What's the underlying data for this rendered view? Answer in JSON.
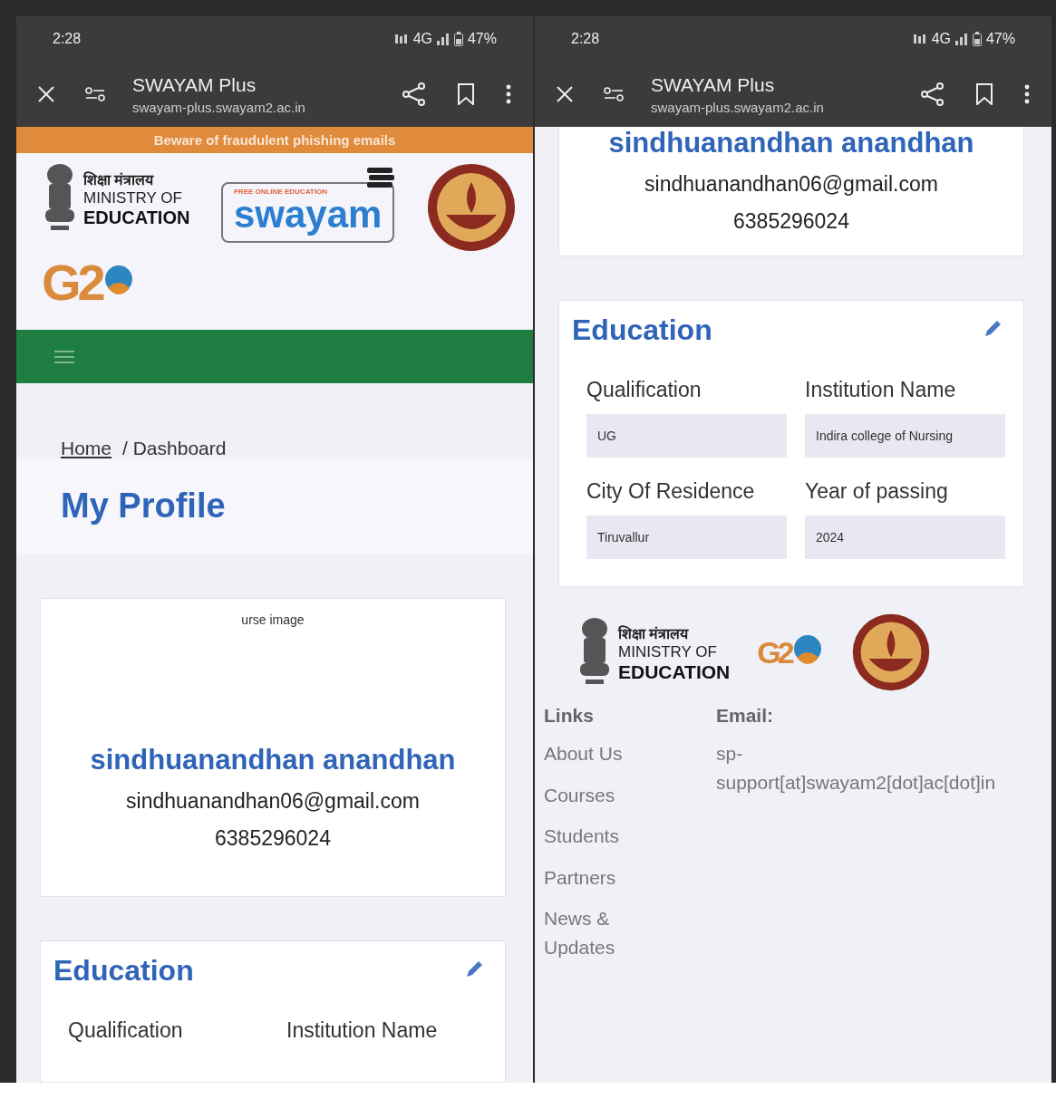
{
  "screens": [
    {
      "status_bar": {
        "time": "2:28",
        "network": "4G",
        "battery": "47%"
      },
      "browser_bar": {
        "title": "SWAYAM Plus",
        "url": "swayam-plus.swayam2.ac.in"
      },
      "content": [
        {
          "kind": "banner",
          "text": "Beware of fraudulent phishing emails"
        },
        {
          "kind": "logos",
          "ministry": {
            "hindi": "शिक्षा मंत्रालय",
            "line1": "MINISTRY OF",
            "line2": "EDUCATION"
          },
          "swayam": {
            "tagline": "FREE ONLINE EDUCATION",
            "name": "swayam"
          },
          "g20": "G2"
        },
        {
          "kind": "navbar"
        },
        {
          "kind": "breadcrumb",
          "items": [
            "Home",
            "/ Dashboard"
          ]
        },
        {
          "kind": "page_title",
          "text": "My Profile"
        },
        {
          "kind": "profile_card",
          "image_alt": "urse image",
          "name": "sindhuanandhan anandhan",
          "email": "sindhuanandhan06@gmail.com",
          "phone": "6385296024"
        },
        {
          "kind": "education_card",
          "title": "Education",
          "fields": [
            {
              "label": "Qualification"
            },
            {
              "label": "Institution Name"
            }
          ]
        }
      ]
    },
    {
      "status_bar": {
        "time": "2:28",
        "network": "4G",
        "battery": "47%"
      },
      "browser_bar": {
        "title": "SWAYAM Plus",
        "url": "swayam-plus.swayam2.ac.in"
      },
      "content": [
        {
          "kind": "profile_card",
          "name": "sindhuanandhan anandhan",
          "email": "sindhuanandhan06@gmail.com",
          "phone": "6385296024"
        },
        {
          "kind": "education_card",
          "title": "Education",
          "fields": [
            {
              "label": "Qualification",
              "value": "UG"
            },
            {
              "label": "Institution Name",
              "value": "Indira college of Nursing"
            },
            {
              "label": "City Of Residence",
              "value": "Tiruvallur"
            },
            {
              "label": "Year of passing",
              "value": "2024"
            }
          ]
        },
        {
          "kind": "footer",
          "ministry": {
            "hindi": "शिक्षा मंत्रालय",
            "line1": "MINISTRY OF",
            "line2": "EDUCATION"
          },
          "g20": "G2",
          "links_title": "Links",
          "links": [
            "About Us",
            "Courses",
            "Students",
            "Partners",
            "News & Updates"
          ],
          "email_title": "Email:",
          "email": "sp-support[at]swayam2[dot]ac[dot]in"
        }
      ]
    }
  ]
}
